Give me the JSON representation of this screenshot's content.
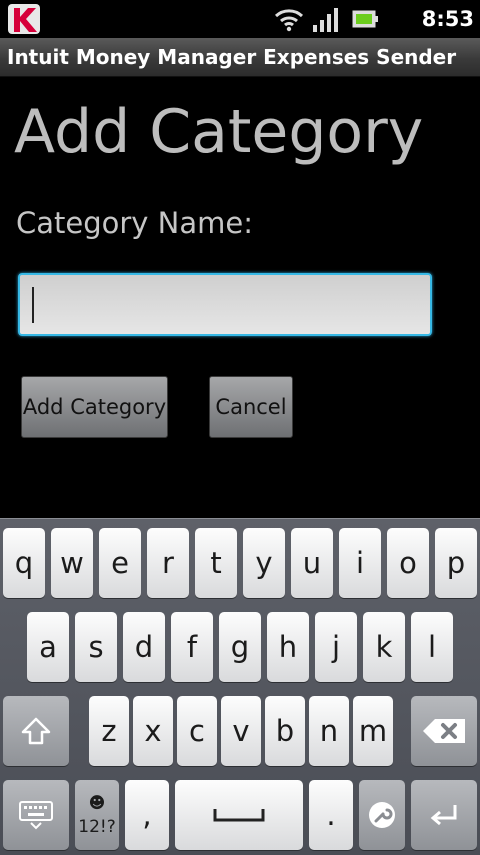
{
  "status_bar": {
    "time": "8:53 am"
  },
  "app_bar": {
    "title": "Intuit Money Manager Expenses Sender"
  },
  "form": {
    "heading": "Add Category",
    "field_label": "Category Name:",
    "field_value": "",
    "add_button": "Add Category",
    "cancel_button": "Cancel"
  },
  "keyboard": {
    "row1": [
      "q",
      "w",
      "e",
      "r",
      "t",
      "y",
      "u",
      "i",
      "o",
      "p"
    ],
    "row2": [
      "a",
      "s",
      "d",
      "f",
      "g",
      "h",
      "j",
      "k",
      "l"
    ],
    "row3": [
      "z",
      "x",
      "c",
      "v",
      "b",
      "n",
      "m"
    ],
    "symbols_label": "12!?",
    "emoji_label": "☻",
    "comma": ",",
    "period": "."
  },
  "colors": {
    "focus_border": "#37b9e6",
    "heading_text": "#bdbdbd"
  }
}
